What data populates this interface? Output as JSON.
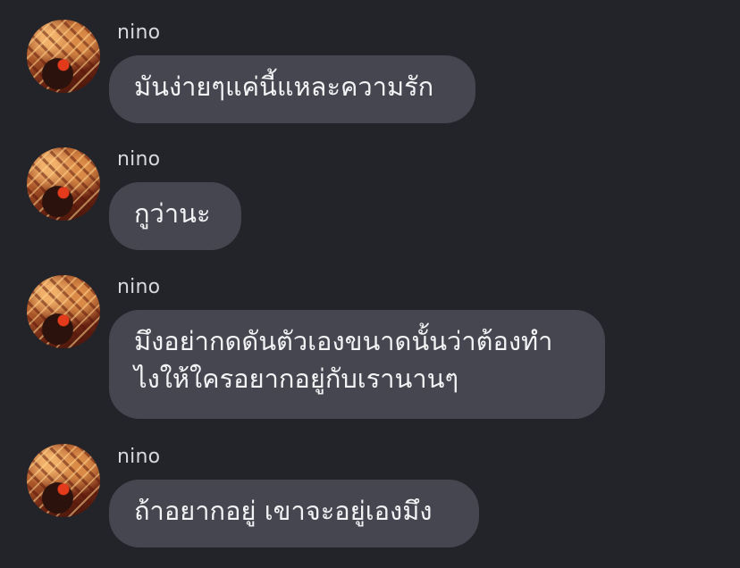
{
  "messages": [
    {
      "sender": "nino",
      "avatar_icon": "profile-photo-icon",
      "lines": [
        "มันง่ายๆแค่นี้แหละความรัก"
      ]
    },
    {
      "sender": "nino",
      "avatar_icon": "profile-photo-icon",
      "lines": [
        "กูว่านะ"
      ]
    },
    {
      "sender": "nino",
      "avatar_icon": "profile-photo-icon",
      "lines": [
        "มึงอย่ากดดันตัวเองขนาดนั้นว่าต้องทำ",
        "ไงให้ใครอยากอยู่กับเรานานๆ"
      ]
    },
    {
      "sender": "nino",
      "avatar_icon": "profile-photo-icon",
      "lines": [
        "ถ้าอยากอยู่ เขาจะอยู่เองมึง"
      ]
    }
  ],
  "colors": {
    "background": "#232429",
    "bubble": "#45464f",
    "text": "#f2f3f5",
    "sender": "#d7d9de"
  }
}
